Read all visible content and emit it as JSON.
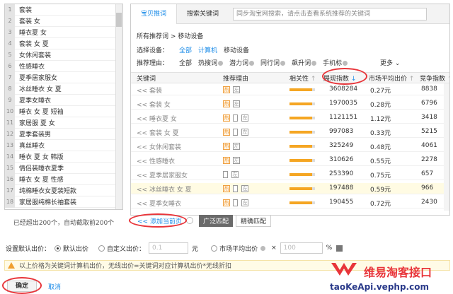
{
  "keyword_list": [
    {
      "n": "1",
      "t": "套装"
    },
    {
      "n": "2",
      "t": "套装 女"
    },
    {
      "n": "3",
      "t": "睡衣夏 女"
    },
    {
      "n": "4",
      "t": "套装 女 夏"
    },
    {
      "n": "5",
      "t": "女休闲套装"
    },
    {
      "n": "6",
      "t": "性感睡衣"
    },
    {
      "n": "7",
      "t": "夏季居家服女"
    },
    {
      "n": "8",
      "t": "冰丝睡衣 女 夏"
    },
    {
      "n": "9",
      "t": "夏季女睡衣"
    },
    {
      "n": "10",
      "t": "睡衣 女 夏 短袖"
    },
    {
      "n": "11",
      "t": "家居服 夏 女"
    },
    {
      "n": "12",
      "t": "夏季套装男"
    },
    {
      "n": "13",
      "t": "真丝睡衣"
    },
    {
      "n": "14",
      "t": "睡衣 夏 女 韩版"
    },
    {
      "n": "15",
      "t": "情侣装睡衣夏季"
    },
    {
      "n": "16",
      "t": "睡衣 女 夏 性感"
    },
    {
      "n": "17",
      "t": "纯棉睡衣女夏装短款"
    },
    {
      "n": "18",
      "t": "家居服纯棉长袖套装"
    }
  ],
  "left_footer": "已经超出200个，自动截取前200个",
  "tabs": {
    "recommend": "宝贝推词",
    "search": "搜索关键词",
    "search_placeholder": "同步淘宝网搜索，请点击查看系统推荐的关键词"
  },
  "breadcrumb": "所有推荐词 > 移动设备",
  "device_filter": {
    "label": "选择设备：",
    "items": [
      "全部",
      "计算机",
      "移动设备"
    ]
  },
  "reason_filter": {
    "label": "推荐理由：",
    "items": [
      "全部",
      "热搜词",
      "潜力词",
      "同行词",
      "飙升词",
      "手机标"
    ],
    "more": "更多"
  },
  "table": {
    "headers": {
      "keyword": "关键词",
      "reason": "推荐理由",
      "relevance": "相关性",
      "impressions": "展现指数",
      "cpc": "市场平均出价",
      "competition": "竞争指数"
    },
    "rows": [
      {
        "kw": "<< 套装",
        "hot": true,
        "phone": false,
        "imp": "3608284",
        "cpc": "0.27元",
        "comp": "8838",
        "rel": 0.9,
        "hl": false
      },
      {
        "kw": "<< 套装 女",
        "hot": true,
        "phone": false,
        "imp": "1970035",
        "cpc": "0.28元",
        "comp": "6796",
        "rel": 0.9,
        "hl": false
      },
      {
        "kw": "<< 睡衣夏 女",
        "hot": true,
        "phone": true,
        "imp": "1121151",
        "cpc": "1.12元",
        "comp": "3418",
        "rel": 0.9,
        "hl": false
      },
      {
        "kw": "<< 套装 女 夏",
        "hot": true,
        "phone": true,
        "imp": "997083",
        "cpc": "0.33元",
        "comp": "5215",
        "rel": 0.9,
        "hl": false
      },
      {
        "kw": "<< 女休闲套装",
        "hot": true,
        "phone": false,
        "imp": "325249",
        "cpc": "0.48元",
        "comp": "4061",
        "rel": 0.9,
        "hl": false
      },
      {
        "kw": "<< 性感睡衣",
        "hot": true,
        "phone": false,
        "imp": "310626",
        "cpc": "0.55元",
        "comp": "2278",
        "rel": 0.9,
        "hl": false
      },
      {
        "kw": "<< 夏季居家服女",
        "hot": false,
        "phone": true,
        "imp": "253390",
        "cpc": "0.75元",
        "comp": "657",
        "rel": 0.9,
        "hl": false
      },
      {
        "kw": "<< 冰丝睡衣 女 夏",
        "hot": true,
        "phone": true,
        "imp": "197488",
        "cpc": "0.59元",
        "comp": "966",
        "rel": 0.9,
        "hl": true
      },
      {
        "kw": "<< 夏季女睡衣",
        "hot": true,
        "phone": true,
        "imp": "190455",
        "cpc": "0.72元",
        "comp": "2430",
        "rel": 0.9,
        "hl": false
      }
    ]
  },
  "bottom": {
    "add_page": "<<  添加当前页",
    "broad": "广泛匹配",
    "exact": "精确匹配"
  },
  "bid_settings": {
    "label": "设置默认出价：",
    "default": "默认出价",
    "custom": "自定义出价：",
    "custom_value": "0.1",
    "unit": "元",
    "market": "市场平均出价",
    "times": "×",
    "percent_value": "100",
    "percent": "%"
  },
  "warning": "以上价格为关键词计算机出价，无线出价=关键词对应计算机出价*无线折扣",
  "buttons": {
    "ok": "确定",
    "cancel": "取消"
  },
  "watermark": {
    "title": "维易淘客接口",
    "url": "taoKeApi.vephp.com"
  },
  "colors": {
    "accent": "#1a8be8",
    "hot": "#f0a040",
    "relevance": "#f5a623",
    "highlight": "#fffbe3",
    "logo": "#e8353a"
  }
}
